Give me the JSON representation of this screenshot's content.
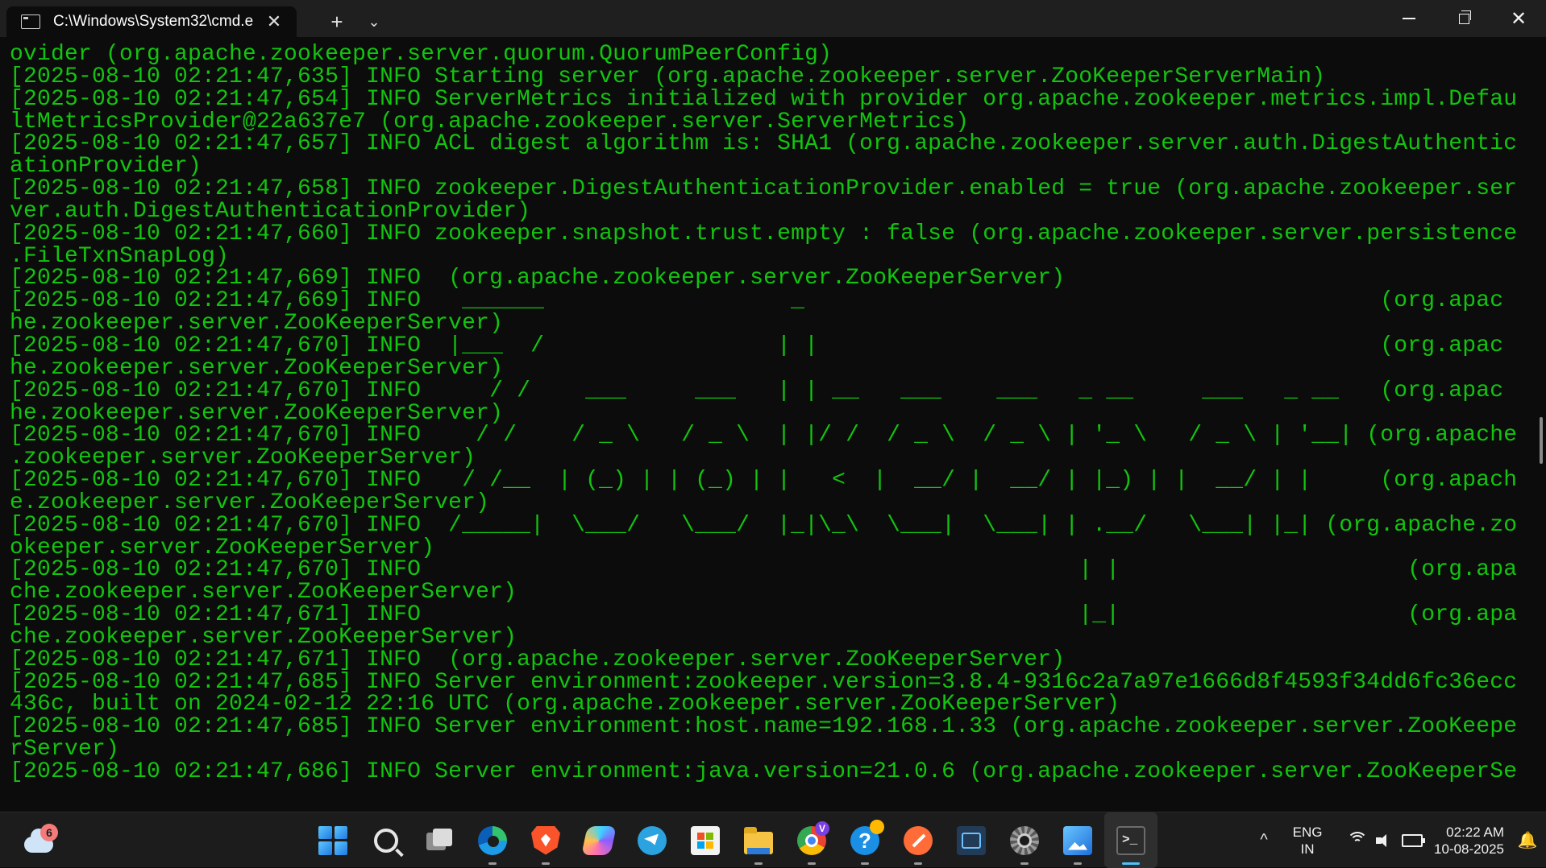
{
  "window": {
    "tab_title": "C:\\Windows\\System32\\cmd.e",
    "new_tab_glyph": "+",
    "dropdown_glyph": "⌄",
    "close_tab_glyph": "✕",
    "minimize_glyph": "",
    "close_glyph": "✕"
  },
  "terminal": {
    "text_color": "#13c40f",
    "lines": [
      "ovider (org.apache.zookeeper.server.quorum.QuorumPeerConfig)",
      "[2025-08-10 02:21:47,635] INFO Starting server (org.apache.zookeeper.server.ZooKeeperServerMain)",
      "[2025-08-10 02:21:47,654] INFO ServerMetrics initialized with provider org.apache.zookeeper.metrics.impl.Defau",
      "ltMetricsProvider@22a637e7 (org.apache.zookeeper.server.ServerMetrics)",
      "[2025-08-10 02:21:47,657] INFO ACL digest algorithm is: SHA1 (org.apache.zookeeper.server.auth.DigestAuthentic",
      "ationProvider)",
      "[2025-08-10 02:21:47,658] INFO zookeeper.DigestAuthenticationProvider.enabled = true (org.apache.zookeeper.ser",
      "ver.auth.DigestAuthenticationProvider)",
      "[2025-08-10 02:21:47,660] INFO zookeeper.snapshot.trust.empty : false (org.apache.zookeeper.server.persistence",
      ".FileTxnSnapLog)",
      "[2025-08-10 02:21:47,669] INFO  (org.apache.zookeeper.server.ZooKeeperServer)",
      "[2025-08-10 02:21:47,669] INFO   ______                  _                                          (org.apac",
      "he.zookeeper.server.ZooKeeperServer)",
      "[2025-08-10 02:21:47,670] INFO  |___  /                 | |                                         (org.apac",
      "he.zookeeper.server.ZooKeeperServer)",
      "[2025-08-10 02:21:47,670] INFO     / /    ___     ___   | | __   ___    ___   _ __     ___   _ __   (org.apac",
      "he.zookeeper.server.ZooKeeperServer)",
      "[2025-08-10 02:21:47,670] INFO    / /    / _ \\   / _ \\  | |/ /  / _ \\  / _ \\ | '_ \\   / _ \\ | '__| (org.apache",
      ".zookeeper.server.ZooKeeperServer)",
      "[2025-08-10 02:21:47,670] INFO   / /__  | (_) | | (_) | |   <  |  __/ |  __/ | |_) | |  __/ | |     (org.apach",
      "e.zookeeper.server.ZooKeeperServer)",
      "[2025-08-10 02:21:47,670] INFO  /_____|  \\___/   \\___/  |_|\\_\\  \\___|  \\___| | .__/   \\___| |_| (org.apache.zo",
      "okeeper.server.ZooKeeperServer)",
      "[2025-08-10 02:21:47,670] INFO                                                | |                     (org.apa",
      "che.zookeeper.server.ZooKeeperServer)",
      "[2025-08-10 02:21:47,671] INFO                                                |_|                     (org.apa",
      "che.zookeeper.server.ZooKeeperServer)",
      "[2025-08-10 02:21:47,671] INFO  (org.apache.zookeeper.server.ZooKeeperServer)",
      "[2025-08-10 02:21:47,685] INFO Server environment:zookeeper.version=3.8.4-9316c2a7a97e1666d8f4593f34dd6fc36ecc",
      "436c, built on 2024-02-12 22:16 UTC (org.apache.zookeeper.server.ZooKeeperServer)",
      "[2025-08-10 02:21:47,685] INFO Server environment:host.name=192.168.1.33 (org.apache.zookeeper.server.ZooKeepe",
      "rServer)",
      "[2025-08-10 02:21:47,686] INFO Server environment:java.version=21.0.6 (org.apache.zookeeper.server.ZooKeeperSe"
    ]
  },
  "taskbar": {
    "weather_badge": "6",
    "chrome_badge": "V",
    "help_glyph": "?",
    "apps": [
      {
        "name": "start-button",
        "icon": "windows-logo-icon"
      },
      {
        "name": "search-button",
        "icon": "search-icon"
      },
      {
        "name": "task-view-button",
        "icon": "task-view-icon"
      },
      {
        "name": "edge-app",
        "icon": "edge-icon"
      },
      {
        "name": "brave-app",
        "icon": "brave-icon"
      },
      {
        "name": "copilot-app",
        "icon": "copilot-icon"
      },
      {
        "name": "telegram-app",
        "icon": "telegram-icon"
      },
      {
        "name": "microsoft-store-app",
        "icon": "store-icon"
      },
      {
        "name": "file-explorer-app",
        "icon": "folder-icon"
      },
      {
        "name": "chrome-app",
        "icon": "chrome-icon"
      },
      {
        "name": "get-help-app",
        "icon": "help-icon"
      },
      {
        "name": "postman-app",
        "icon": "postman-icon"
      },
      {
        "name": "virtualbox-app",
        "icon": "vm-icon"
      },
      {
        "name": "settings-tool-app",
        "icon": "gear-icon"
      },
      {
        "name": "photos-app",
        "icon": "photos-icon"
      },
      {
        "name": "terminal-app",
        "icon": "terminal-icon"
      }
    ],
    "tray": {
      "chevron": "^",
      "lang_line1": "ENG",
      "lang_line2": "IN",
      "time": "02:22 AM",
      "date": "10-08-2025"
    }
  }
}
